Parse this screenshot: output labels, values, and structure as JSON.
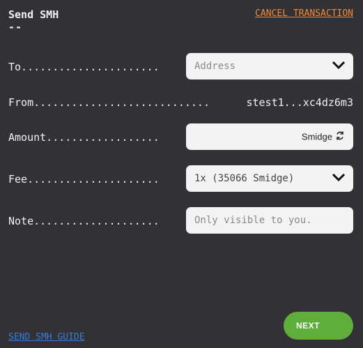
{
  "header": {
    "title": "Send SMH",
    "title_dash": "--",
    "cancel_label": "CANCEL TRANSACTION"
  },
  "form": {
    "to": {
      "label": "To......................",
      "placeholder": "Address"
    },
    "from": {
      "label": "From............................",
      "value": "stest1...xc4dz6m3"
    },
    "amount": {
      "label": "Amount..................",
      "unit": "Smidge"
    },
    "fee": {
      "label": "Fee.....................",
      "value": "1x (35066 Smidge)"
    },
    "note": {
      "label": "Note....................",
      "placeholder": "Only visible to you."
    }
  },
  "footer": {
    "guide_label": "SEND SMH GUIDE",
    "next_label": "NEXT"
  },
  "colors": {
    "background": "#323135",
    "accent_orange": "#f08a3a",
    "link_blue": "#3a7bd5",
    "next_green": "#5fae3c"
  },
  "icons": {
    "dropdown": "chevron-down-icon",
    "swap": "refresh-icon"
  }
}
